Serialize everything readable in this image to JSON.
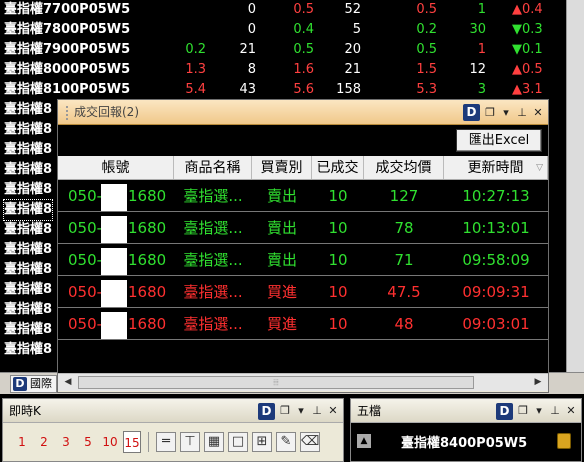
{
  "quote_board": {
    "rows": [
      {
        "name": "臺指權7700P05W5",
        "c1": "",
        "c2": "0",
        "c3": "0.5",
        "c4": "52",
        "c5": "0.5",
        "c6": "1",
        "c7": "▲0.4",
        "c1c": "green",
        "c3c": "red",
        "c5c": "red",
        "c6c": "green",
        "c7c": "red"
      },
      {
        "name": "臺指權7800P05W5",
        "c1": "",
        "c2": "0",
        "c3": "0.4",
        "c4": "5",
        "c5": "0.2",
        "c6": "30",
        "c7": "▼0.3",
        "c1c": "green",
        "c3c": "green",
        "c5c": "green",
        "c6c": "green",
        "c7c": "green"
      },
      {
        "name": "臺指權7900P05W5",
        "c1": "0.2",
        "c2": "21",
        "c3": "0.5",
        "c4": "20",
        "c5": "0.5",
        "c6": "1",
        "c7": "▼0.1",
        "c1c": "green",
        "c3c": "green",
        "c5c": "green",
        "c6c": "red",
        "c7c": "green"
      },
      {
        "name": "臺指權8000P05W5",
        "c1": "1.3",
        "c2": "8",
        "c3": "1.6",
        "c4": "21",
        "c5": "1.5",
        "c6": "12",
        "c7": "▲0.5",
        "c1c": "red",
        "c3c": "red",
        "c5c": "red",
        "c6c": "white",
        "c7c": "red"
      },
      {
        "name": "臺指權8100P05W5",
        "c1": "5.4",
        "c2": "43",
        "c3": "5.6",
        "c4": "158",
        "c5": "5.3",
        "c6": "3",
        "c7": "▲3.1",
        "c1c": "red",
        "c3c": "red",
        "c5c": "red",
        "c6c": "green",
        "c7c": "red"
      },
      {
        "name": "臺指權8",
        "c1": "",
        "c2": "",
        "c3": "",
        "c4": "",
        "c5": "",
        "c6": "",
        "c7": ""
      },
      {
        "name": "臺指權8",
        "c1": "",
        "c2": "",
        "c3": "",
        "c4": "",
        "c5": "",
        "c6": "",
        "c7": ""
      },
      {
        "name": "臺指權8",
        "c1": "",
        "c2": "",
        "c3": "",
        "c4": "",
        "c5": "",
        "c6": "",
        "c7": ""
      },
      {
        "name": "臺指權8",
        "c1": "",
        "c2": "",
        "c3": "",
        "c4": "",
        "c5": "",
        "c6": "",
        "c7": ""
      },
      {
        "name": "臺指權8",
        "c1": "",
        "c2": "",
        "c3": "",
        "c4": "",
        "c5": "",
        "c6": "",
        "c7": ""
      },
      {
        "name": "臺指權8",
        "c1": "",
        "c2": "",
        "c3": "",
        "c4": "",
        "c5": "",
        "c6": "",
        "c7": ""
      },
      {
        "name": "臺指權8",
        "c1": "",
        "c2": "",
        "c3": "",
        "c4": "",
        "c5": "",
        "c6": "",
        "c7": ""
      },
      {
        "name": "臺指權8",
        "c1": "",
        "c2": "",
        "c3": "",
        "c4": "",
        "c5": "",
        "c6": "",
        "c7": ""
      },
      {
        "name": "臺指權8",
        "c1": "",
        "c2": "",
        "c3": "",
        "c4": "",
        "c5": "",
        "c6": "",
        "c7": ""
      },
      {
        "name": "臺指權8",
        "c1": "",
        "c2": "",
        "c3": "",
        "c4": "",
        "c5": "",
        "c6": "",
        "c7": ""
      },
      {
        "name": "臺指權8",
        "c1": "",
        "c2": "",
        "c3": "",
        "c4": "",
        "c5": "",
        "c6": "",
        "c7": ""
      },
      {
        "name": "臺指權8",
        "c1": "",
        "c2": "",
        "c3": "",
        "c4": "",
        "c5": "",
        "c6": "",
        "c7": ""
      },
      {
        "name": "臺指權8",
        "c1": "",
        "c2": "",
        "c3": "",
        "c4": "",
        "c5": "",
        "c6": "",
        "c7": ""
      }
    ],
    "tab_label": "國際"
  },
  "dialog": {
    "title": "成交回報(2)",
    "excel_label": "匯出Excel",
    "columns": [
      "帳號",
      "商品名稱",
      "買賣別",
      "已成交",
      "成交均價",
      "更新時間"
    ],
    "sort_glyph": "▽",
    "rows": [
      {
        "acct_pre": "050-",
        "acct_suf": "1680",
        "product": "臺指選...",
        "side": "賣出",
        "filled": "10",
        "avg": "127",
        "time": "10:27:13",
        "color": "#30e030"
      },
      {
        "acct_pre": "050-",
        "acct_suf": "1680",
        "product": "臺指選...",
        "side": "賣出",
        "filled": "10",
        "avg": "78",
        "time": "10:13:01",
        "color": "#30e030"
      },
      {
        "acct_pre": "050-",
        "acct_suf": "1680",
        "product": "臺指選...",
        "side": "賣出",
        "filled": "10",
        "avg": "71",
        "time": "09:58:09",
        "color": "#30e030"
      },
      {
        "acct_pre": "050-",
        "acct_suf": "1680",
        "product": "臺指選...",
        "side": "買進",
        "filled": "10",
        "avg": "47.5",
        "time": "09:09:31",
        "color": "#ff3030"
      },
      {
        "acct_pre": "050-",
        "acct_suf": "1680",
        "product": "臺指選...",
        "side": "買進",
        "filled": "10",
        "avg": "48",
        "time": "09:03:01",
        "color": "#ff3030"
      }
    ],
    "scroll_thumb": "⦙⦙⦙"
  },
  "kline_panel": {
    "title": "即時K",
    "periods": [
      "1",
      "2",
      "3",
      "5",
      "10",
      "15"
    ],
    "selected_period": "15"
  },
  "wudang_panel": {
    "title": "五檔",
    "symbol": "臺指權8400P05W5"
  },
  "dock_logo": "D"
}
